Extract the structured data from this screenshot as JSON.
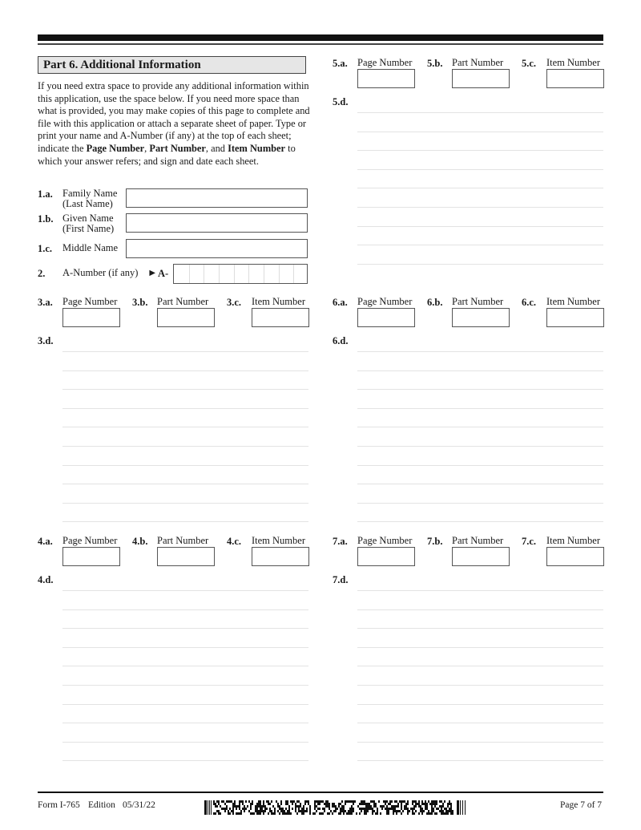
{
  "part": {
    "title": "Part 6.  Additional Information",
    "intro_1": "If you need extra space to provide any additional information within this application, use the space below.  If you need more space than what is provided, you may make copies of this page to complete and file with this application or attach a separate sheet of paper.  Type or print your name and A-Number (if any) at the top of each sheet; indicate the ",
    "intro_bold_1": "Page Number",
    "intro_sep_1": ", ",
    "intro_bold_2": "Part Number",
    "intro_sep_2": ", and ",
    "intro_bold_3": "Item Number",
    "intro_2": " to which your answer refers; and sign and date each sheet."
  },
  "fields": {
    "family_name": {
      "num": "1.a.",
      "label_1": "Family Name",
      "label_2": "(Last Name)",
      "value": ""
    },
    "given_name": {
      "num": "1.b.",
      "label_1": "Given Name",
      "label_2": "(First Name)",
      "value": ""
    },
    "middle_name": {
      "num": "1.c.",
      "label": "Middle Name",
      "value": ""
    },
    "a_number": {
      "num": "2.",
      "label": "A-Number (if any)",
      "arrow": "►",
      "prefix": "A-",
      "value": ""
    }
  },
  "sections": [
    {
      "id": "3",
      "page": {
        "num": "3.a.",
        "label": "Page Number",
        "value": ""
      },
      "part": {
        "num": "3.b.",
        "label": "Part Number",
        "value": ""
      },
      "item": {
        "num": "3.c.",
        "label": "Item Number",
        "value": ""
      },
      "answer": {
        "num": "3.d.",
        "value": ""
      }
    },
    {
      "id": "4",
      "page": {
        "num": "4.a.",
        "label": "Page Number",
        "value": ""
      },
      "part": {
        "num": "4.b.",
        "label": "Part Number",
        "value": ""
      },
      "item": {
        "num": "4.c.",
        "label": "Item Number",
        "value": ""
      },
      "answer": {
        "num": "4.d.",
        "value": ""
      }
    },
    {
      "id": "5",
      "page": {
        "num": "5.a.",
        "label": "Page Number",
        "value": ""
      },
      "part": {
        "num": "5.b.",
        "label": "Part Number",
        "value": ""
      },
      "item": {
        "num": "5.c.",
        "label": "Item Number",
        "value": ""
      },
      "answer": {
        "num": "5.d.",
        "value": ""
      }
    },
    {
      "id": "6",
      "page": {
        "num": "6.a.",
        "label": "Page Number",
        "value": ""
      },
      "part": {
        "num": "6.b.",
        "label": "Part Number",
        "value": ""
      },
      "item": {
        "num": "6.c.",
        "label": "Item Number",
        "value": ""
      },
      "answer": {
        "num": "6.d.",
        "value": ""
      }
    },
    {
      "id": "7",
      "page": {
        "num": "7.a.",
        "label": "Page Number",
        "value": ""
      },
      "part": {
        "num": "7.b.",
        "label": "Part Number",
        "value": ""
      },
      "item": {
        "num": "7.c.",
        "label": "Item Number",
        "value": ""
      },
      "answer": {
        "num": "7.d.",
        "value": ""
      }
    }
  ],
  "footer": {
    "form": "Form I-765",
    "edition_label": "Edition",
    "edition_date": "05/31/22",
    "page": "Page 7 of 7"
  }
}
